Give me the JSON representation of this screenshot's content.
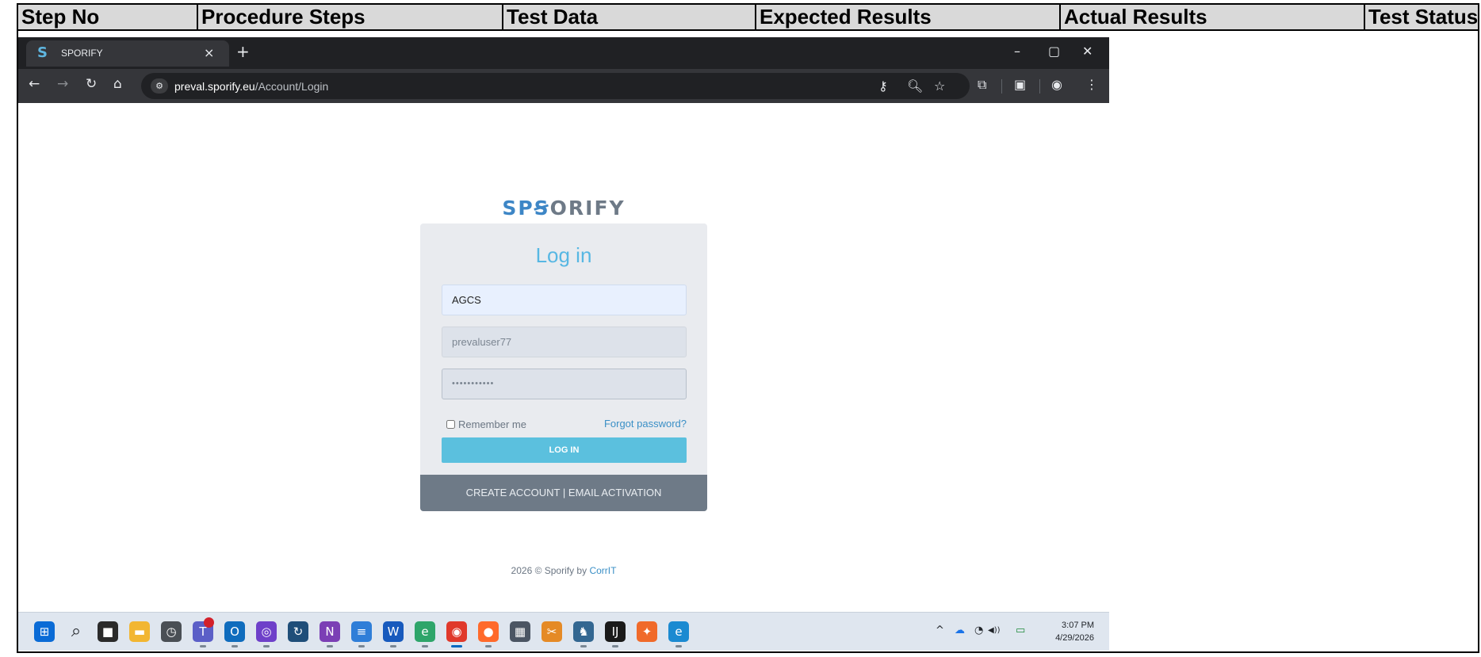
{
  "doc_table": {
    "headers": [
      "Step No",
      "Procedure Steps",
      "Test Data",
      "Expected Results",
      "Actual Results",
      "Test Status"
    ]
  },
  "browser": {
    "tab_title": "SPORIFY",
    "tab_logo": "S",
    "tab_close": "×",
    "new_tab": "+",
    "window_controls": {
      "minimize": "–",
      "restore": "▢",
      "close": "✕"
    },
    "nav": {
      "back": "←",
      "forward": "→",
      "reload": "↻",
      "home": "⌂"
    },
    "site_info_icon": "⚙",
    "url_host": "preval.sporify.eu",
    "url_path": "/Account/Login",
    "omnibox_icons": {
      "password_key": "⚷",
      "zoom": "🔍︎",
      "bookmark": "☆"
    },
    "toolbar_icons": {
      "extensions": "⧉",
      "reading_mode": "▣",
      "profile": "◉",
      "menu": "⋮"
    }
  },
  "page": {
    "brand_s": "SP",
    "brand_rest": "ORIFY",
    "brand_o": "Ꞩ",
    "login_title": "Log in",
    "organization_value": "AGCS",
    "username_value": "prevaluser77",
    "password_mask": "•••••••••••",
    "remember_label": "Remember me",
    "forgot_link": "Forgot password?",
    "login_button": "LOG IN",
    "create_account": "CREATE ACCOUNT",
    "footer_separator": "|",
    "email_activation": "EMAIL ACTIVATION",
    "copyright_prefix": "2026 © Sporify by ",
    "copyright_link": "CorrIT"
  },
  "taskbar": {
    "apps": [
      {
        "name": "start-icon",
        "glyph": "⊞",
        "color": "#0a6bd6"
      },
      {
        "name": "search-icon",
        "glyph": "⌕",
        "color": "#1f2328"
      },
      {
        "name": "task-view-icon",
        "glyph": "■",
        "color": "#2b2b2b"
      },
      {
        "name": "file-explorer-icon",
        "glyph": "▬",
        "color": "#f2b632"
      },
      {
        "name": "clock-app-icon",
        "glyph": "◷",
        "color": "#4a4f55"
      },
      {
        "name": "teams-icon",
        "glyph": "T",
        "color": "#5b5fc7"
      },
      {
        "name": "outlook-icon",
        "glyph": "O",
        "color": "#0f6cbd"
      },
      {
        "name": "github-icon",
        "glyph": "◎",
        "color": "#6e40c9"
      },
      {
        "name": "sync-app-icon",
        "glyph": "↻",
        "color": "#1f4e79"
      },
      {
        "name": "onenote-icon",
        "glyph": "N",
        "color": "#7b3fb5"
      },
      {
        "name": "notepad-icon",
        "glyph": "≡",
        "color": "#2f7ed8"
      },
      {
        "name": "word-icon",
        "glyph": "W",
        "color": "#185abd"
      },
      {
        "name": "edge-dev-icon",
        "glyph": "e",
        "color": "#2ea56a"
      },
      {
        "name": "chrome-icon",
        "glyph": "◉",
        "color": "#e0392b"
      },
      {
        "name": "firefox-icon",
        "glyph": "●",
        "color": "#ff6a2b"
      },
      {
        "name": "calculator-icon",
        "glyph": "▦",
        "color": "#4b5563"
      },
      {
        "name": "snipping-tool-icon",
        "glyph": "✂",
        "color": "#e58a26"
      },
      {
        "name": "postgres-icon",
        "glyph": "♞",
        "color": "#336791"
      },
      {
        "name": "intellij-icon",
        "glyph": "IJ",
        "color": "#1a1a1a"
      },
      {
        "name": "compass-app-icon",
        "glyph": "✦",
        "color": "#f06a2a"
      },
      {
        "name": "edge-icon",
        "glyph": "e",
        "color": "#1b8ad1"
      }
    ],
    "tray_chevron": "^",
    "tray_cloud": "☁",
    "tray_wifi": "◔",
    "tray_volume": "◀))",
    "tray_battery": "▭",
    "time": "3:07 PM",
    "date": "4/29/2026"
  }
}
